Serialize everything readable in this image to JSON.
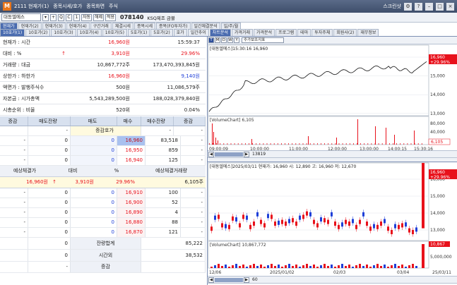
{
  "window": {
    "title": "2111 현재가(1)",
    "crumb1": "종목시세/호가",
    "crumb2": "종목화면",
    "crumb3": "주식",
    "right_label": "스크린샷"
  },
  "toolbar": {
    "code": "대동엘에스",
    "stock_number": "078140",
    "stock_name": "KSQ제조 금불",
    "buttons": [
      "+",
      "Q",
      "C",
      "1",
      "자동",
      "해제",
      "적용"
    ]
  },
  "tabs_row1": [
    "현재가",
    "현재가(2)",
    "현재가(3)",
    "현재가(4)",
    "구간거래",
    "체결시세",
    "종목시세",
    "종목(FO투자가)",
    "일간체결분석",
    "일/주/월"
  ],
  "tabs_row2": [
    "10호가(1)",
    "10호가(2)",
    "10호가(3)",
    "10호가(4)",
    "10호가(5)",
    "5호가(1)",
    "5호가(2)",
    "호가",
    "일간추이",
    "차트분석",
    "가격거래",
    "가격분석",
    "프로그램",
    "테마",
    "투자주체",
    "회원사(2)",
    "재무정보"
  ],
  "info": [
    {
      "label": "현재가 : 시간",
      "v1": "16,960원",
      "v1c": "red",
      "v2": "15:59:37",
      "v2c": ""
    },
    {
      "label": "대비 : %",
      "arrow": "↑",
      "v1": "3,910원",
      "v1c": "red",
      "v2": "29.96%",
      "v2c": "red"
    },
    {
      "label": "거래량 : 대금",
      "v1": "10,867,772주",
      "v1c": "",
      "v2": "173,470,393,845원",
      "v2c": ""
    },
    {
      "label": "상한가 : 하한가",
      "v1": "16,960원",
      "v1c": "red",
      "v2": "9,140원",
      "v2c": "blue"
    },
    {
      "label": "액면가 : 발행주식수",
      "v1": "500원",
      "v1c": "",
      "v2": "11,086,579주",
      "v2c": ""
    },
    {
      "label": "자본금 : 시가총액",
      "v1": "5,543,289,500원",
      "v1c": "",
      "v2": "188,028,379,840원",
      "v2c": ""
    },
    {
      "label": "시총순위 : 비율",
      "v1": "520위",
      "v1c": "",
      "v2": "0.04%",
      "v2c": ""
    }
  ],
  "orderbook": {
    "headers": [
      "증감",
      "매도잔량",
      "매도",
      "매수",
      "매수잔량",
      "증감"
    ],
    "top_row": {
      "c2": "-",
      "mid": "증감호가",
      "c4": "-",
      "c6": "-"
    },
    "sell_rows": [
      {
        "inc": "-",
        "qty": "0",
        "price": "0",
        "bid": "16,960",
        "bidqty": "83,518",
        "binc": "-"
      },
      {
        "inc": "-",
        "qty": "0",
        "price": "0",
        "bid": "16,950",
        "bidqty": "859",
        "binc": "-"
      },
      {
        "inc": "-",
        "qty": "0",
        "price": "0",
        "bid": "16,940",
        "bidqty": "125",
        "binc": "-"
      }
    ],
    "expected_headers": [
      "예상체결가",
      "대비",
      "%",
      "예상체결거래량"
    ],
    "expected": {
      "price": "16,960원",
      "arrow": "↑",
      "diff": "3,910원",
      "pct": "29.96%",
      "vol": "6,105주"
    },
    "buy_rows": [
      {
        "inc": "-",
        "qty": "0",
        "price": "0",
        "bid": "16,910",
        "bidqty": "100",
        "binc": "-"
      },
      {
        "inc": "-",
        "qty": "0",
        "price": "0",
        "bid": "16,900",
        "bidqty": "52",
        "binc": "-"
      },
      {
        "inc": "-",
        "qty": "0",
        "price": "0",
        "bid": "16,890",
        "bidqty": "4",
        "binc": "-"
      },
      {
        "inc": "-",
        "qty": "0",
        "price": "0",
        "bid": "16,880",
        "bidqty": "88",
        "binc": "-"
      },
      {
        "inc": "-",
        "qty": "0",
        "price": "0",
        "bid": "16,870",
        "bidqty": "121",
        "binc": "-"
      }
    ],
    "total": {
      "qty": "0",
      "label": "잔량합계",
      "bidtotal": "85,222"
    },
    "after": {
      "qty": "0",
      "label": "시간외",
      "bidtotal": "38,532"
    },
    "last": {
      "label": "증감",
      "c1": "-"
    }
  },
  "chart1": {
    "select": "주가보조지표",
    "title": "[대동엘에스]15:30:16 16,960",
    "price_tag": "16,960",
    "pct_tag": "+29.96%",
    "y_ticks": [
      "16,000",
      "15,000",
      "14,000",
      "13,000"
    ],
    "vol_title": "[VolumeChart] 6,105",
    "vol_ticks": [
      "80,000",
      "40,000"
    ],
    "vol_tag": "6,105",
    "x_ticks": [
      "09:00:09",
      "10:00:00",
      "11:00:00",
      "12:00:00",
      "13:00:00",
      "14:00:15",
      "15:30:16"
    ],
    "zoom": "13819"
  },
  "chart2": {
    "title": "[대동엘에스]2025/03/11 현재가: 16,960 시: 12,890 고: 16,960 저: 12,670",
    "price_tag": "16,960",
    "pct_tag": "+29.96%",
    "y_ticks": [
      "16,000",
      "15,000",
      "14,000",
      "13,000"
    ],
    "vol_title": "[VolumeChart] 10,867,772",
    "vol_tag": "10,867",
    "vol_ticks": [
      "5,000,000"
    ],
    "x_ticks": [
      "12/06",
      "2025/01/02",
      "02/03",
      "03/04",
      "25/03/11"
    ],
    "zoom": "60"
  },
  "colors": {
    "up": "#e8111b",
    "down": "#1f3fd8",
    "tab_active": "#4a6cb0"
  }
}
